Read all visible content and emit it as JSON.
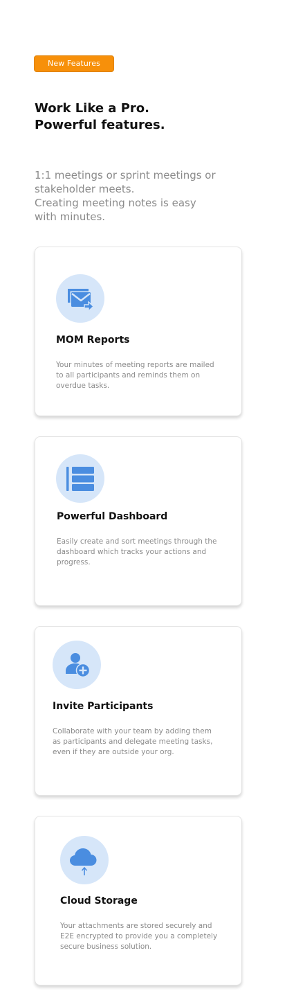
{
  "badge": {
    "label": "New Features"
  },
  "headline": {
    "line1": "Work Like a Pro.",
    "line2": "Powerful features."
  },
  "intro": {
    "line1": "1:1 meetings or sprint meetings or",
    "line2": "stakeholder meets.",
    "line3": "Creating meeting notes is easy",
    "line4": "with minutes."
  },
  "colors": {
    "badge": "#f7900a",
    "icon_fg": "#4a8de0",
    "icon_bg": "#d6e6f9",
    "heading": "#111111",
    "muted_text": "#8a8a8a"
  },
  "features": [
    {
      "icon": "mail-forward-icon",
      "title": "MOM Reports",
      "description": "Your minutes of meeting reports are mailed to all participants and reminds them on overdue tasks."
    },
    {
      "icon": "dashboard-list-icon",
      "title": "Powerful Dashboard",
      "description": "Easily create and sort meetings through the dashboard which tracks your actions and progress."
    },
    {
      "icon": "add-user-icon",
      "title": "Invite Participants",
      "description": "Collaborate with your team by adding them as participants and delegate meeting tasks, even if they are outside your org."
    },
    {
      "icon": "cloud-upload-icon",
      "title": "Cloud Storage",
      "description": "Your attachments are stored securely and E2E encrypted to provide you a completely secure business solution."
    }
  ]
}
